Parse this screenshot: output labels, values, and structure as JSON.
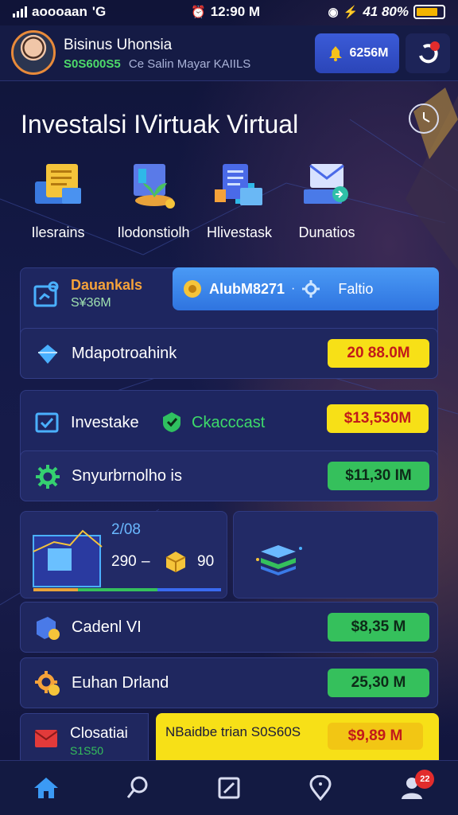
{
  "status_bar": {
    "carrier": "aoooaan",
    "network": "'G",
    "time": "12:90 M",
    "battery": "41 80%"
  },
  "profile": {
    "name": "Bisinus Uhonsia",
    "balance": "S0S600S5",
    "subtitle": "Ce Salin Mayar KAIILS"
  },
  "header": {
    "coin_value": "6256M"
  },
  "title": "Investalsi IVirtuak Virtual",
  "categories": [
    {
      "label": "Ilesrains",
      "icon": "document-folder-icon"
    },
    {
      "label": "Ilodonstiolh",
      "icon": "money-plant-icon"
    },
    {
      "label": "Hlivestask",
      "icon": "report-stack-icon"
    },
    {
      "label": "Dunatios",
      "icon": "mail-laptop-icon"
    }
  ],
  "summary": {
    "title": "Dauankals",
    "value": "S¥36M",
    "code": "AlubM8271",
    "action": "Faltio"
  },
  "rows": [
    {
      "label": "Mdapotroahink",
      "value": "20 88.0M",
      "color": "#f7e017"
    },
    {
      "label": "Investake",
      "tag": "Ckacccast",
      "value": "$13,530M",
      "color": "#f7e017"
    },
    {
      "label": "Snyurbrnolho is",
      "value": "$11,30 IM",
      "color": "#35c05c"
    },
    {
      "label": "Cadenl VI",
      "value": "$8,35 M",
      "color": "#35c05c"
    },
    {
      "label": "Euhan Drland",
      "value": "25,30 M",
      "color": "#35c05c"
    }
  ],
  "chart_card": {
    "date": "2/08",
    "range_start": "290",
    "range_end": "90"
  },
  "bottom_card": {
    "title": "Closatiai",
    "subtitle": "S1S50",
    "banner": "NBaidbe trian S0S60S",
    "value": "$9,89 M"
  },
  "tabbar": {
    "badge": "22"
  },
  "colors": {
    "accent_blue": "#3b7ee8",
    "accent_green": "#35c05c",
    "accent_yellow": "#f7e017",
    "bg": "#141a48"
  }
}
